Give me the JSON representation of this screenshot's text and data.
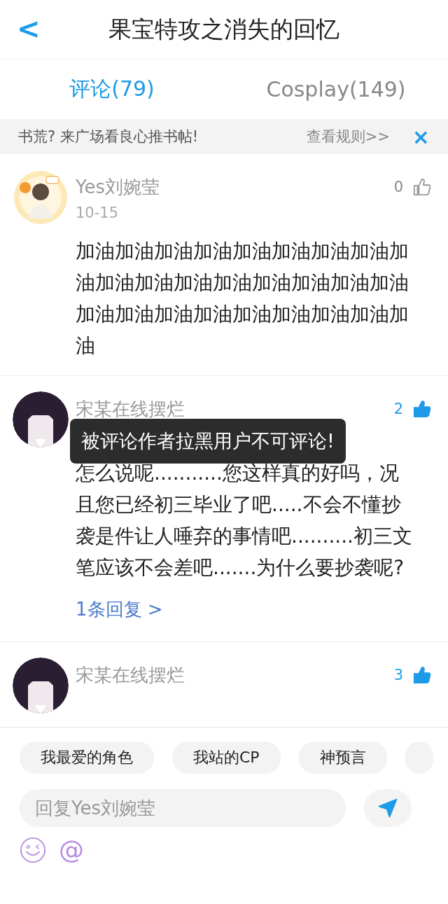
{
  "header": {
    "back": "<",
    "title": "果宝特攻之消失的回忆"
  },
  "tabs": [
    {
      "label": "评论(79)",
      "selected": true
    },
    {
      "label": "Cosplay(149)",
      "selected": false
    }
  ],
  "banner": {
    "text": "书荒? 来广场看良心推书帖!",
    "link": "查看规则>>",
    "close": "×"
  },
  "comments": [
    {
      "name": "Yes刘婉莹",
      "date": "10-15",
      "likes": "0",
      "liked": false,
      "kind": "author",
      "text": "加油加油加油加油加油加油加油加油加油加油加油加油加油加油加油加油加油加油加油加油加油加油加油加油加油加油"
    },
    {
      "name": "宋某在线摆烂",
      "likes": "2",
      "liked": true,
      "kind": "dark",
      "text": "怎么说呢...........您这样真的好吗，况且您已经初三毕业了吧.....不会不懂抄袭是件让人唾弃的事情吧..........初三文笔应该不会差吧.......为什么要抄袭呢?",
      "replies": "1条回复 >"
    },
    {
      "name": "宋某在线摆烂",
      "likes": "3",
      "liked": true,
      "kind": "dark"
    }
  ],
  "toast": "被评论作者拉黑用户不可评论!",
  "chips": [
    "我最爱的角色",
    "我站的CP",
    "神预言"
  ],
  "reply": {
    "placeholder": "回复Yes刘婉莹"
  },
  "at": "@"
}
